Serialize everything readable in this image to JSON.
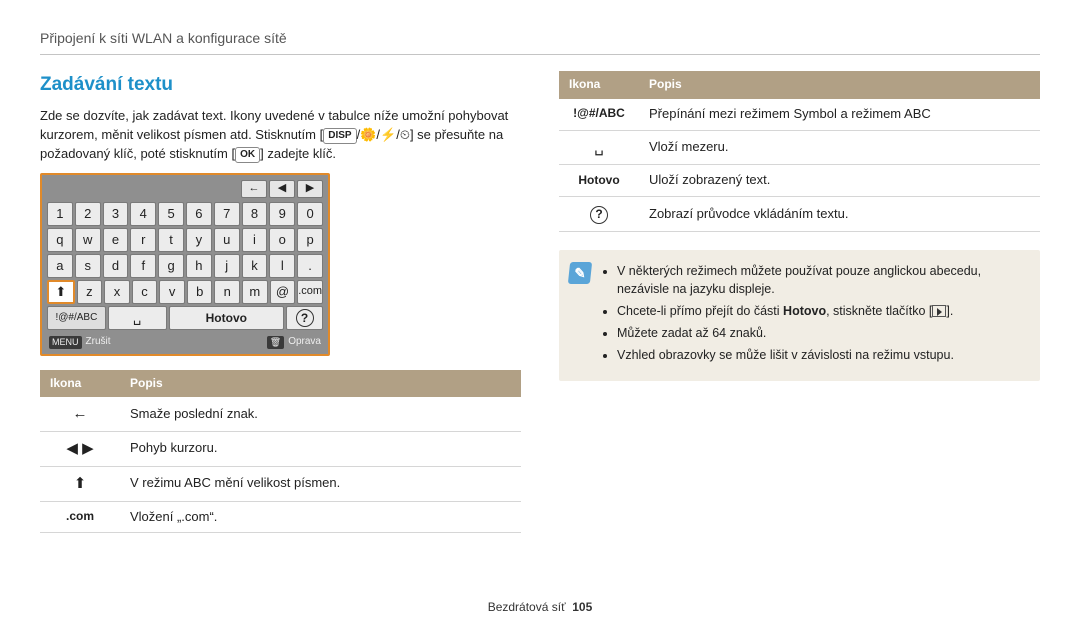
{
  "breadcrumb": "Připojení k síti WLAN a konfigurace sítě",
  "section_title": "Zadávání textu",
  "intro_a": "Zde se dozvíte, jak zadávat text. Ikony uvedené v tabulce níže umožní pohybovat kurzorem, měnit velikost písmen atd. Stisknutím [",
  "intro_disp": "DISP",
  "intro_b": "/",
  "intro_c": "/",
  "intro_d": "/",
  "intro_e": "] se přesuňte na požadovaný klíč, poté stisknutím [",
  "intro_ok": "OK",
  "intro_f": "] zadejte klíč.",
  "keyboard": {
    "top": [
      "←",
      "◀",
      "▶"
    ],
    "row1": [
      "1",
      "2",
      "3",
      "4",
      "5",
      "6",
      "7",
      "8",
      "9",
      "0"
    ],
    "row2": [
      "q",
      "w",
      "e",
      "r",
      "t",
      "y",
      "u",
      "i",
      "o",
      "p"
    ],
    "row3": [
      "a",
      "s",
      "d",
      "f",
      "g",
      "h",
      "j",
      "k",
      "l",
      "."
    ],
    "row4": [
      "⬆",
      "z",
      "x",
      "c",
      "v",
      "b",
      "n",
      "m",
      "@",
      ".com"
    ],
    "row5_left": "!@#/ABC",
    "row5_space": "␣",
    "row5_done": "Hotovo",
    "row5_help": "?",
    "footer_left_tag": "MENU",
    "footer_left": "Zrušit",
    "footer_right_tag": "🗑",
    "footer_right": "Oprava"
  },
  "left_table": {
    "header_icon": "Ikona",
    "header_desc": "Popis",
    "rows": [
      {
        "icon": "←",
        "icon_name": "backspace-icon",
        "desc": "Smaže poslední znak."
      },
      {
        "icon": "◀  ▶",
        "icon_name": "cursor-move-icon",
        "desc": "Pohyb kurzoru."
      },
      {
        "icon": "⬆",
        "icon_name": "shift-icon",
        "desc": "V režimu ABC mění velikost písmen."
      },
      {
        "icon": ".com",
        "icon_name": "dotcom-icon",
        "desc": "Vložení „.com“."
      }
    ]
  },
  "right_table": {
    "header_icon": "Ikona",
    "header_desc": "Popis",
    "rows": [
      {
        "icon": "!@#/ABC",
        "icon_name": "mode-switch-icon",
        "desc": "Přepínání mezi režimem Symbol a režimem ABC"
      },
      {
        "icon": "␣",
        "icon_name": "space-icon",
        "desc": "Vloží mezeru."
      },
      {
        "icon": "Hotovo",
        "icon_name": "done-icon",
        "desc": "Uloží zobrazený text."
      },
      {
        "icon": "?",
        "icon_name": "help-icon",
        "desc": "Zobrazí průvodce vkládáním textu."
      }
    ]
  },
  "note": {
    "b1a": "V některých režimech můžete používat pouze anglickou abecedu, nezávisle na jazyku displeje.",
    "b2a": "Chcete-li přímo přejít do části ",
    "b2b": "Hotovo",
    "b2c": ", stiskněte tlačítko [",
    "b2d": "].",
    "b3": "Můžete zadat až 64 znaků.",
    "b4": "Vzhled obrazovky se může lišit v závislosti na režimu vstupu."
  },
  "footer": {
    "section": "Bezdrátová síť",
    "page": "105"
  }
}
